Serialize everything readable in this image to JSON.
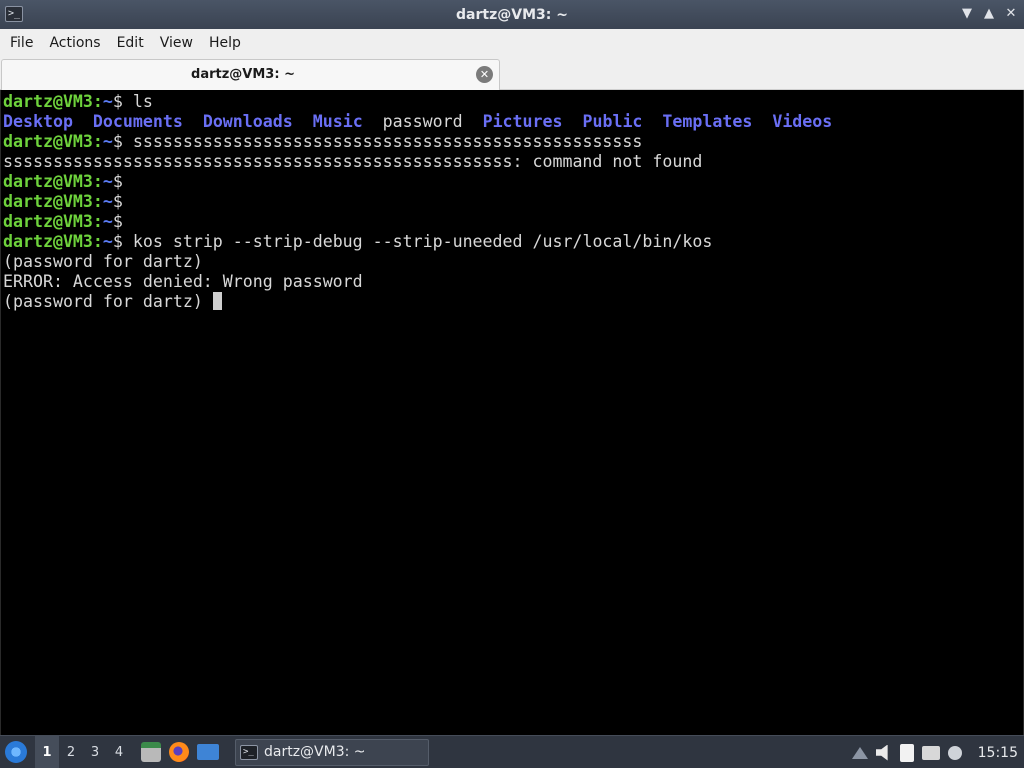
{
  "window": {
    "title": "dartz@VM3: ~",
    "controls": [
      "minimize",
      "maximize",
      "close"
    ]
  },
  "menu": [
    "File",
    "Actions",
    "Edit",
    "View",
    "Help"
  ],
  "tabs": [
    {
      "label": "dartz@VM3: ~"
    }
  ],
  "terminal": {
    "prompt_user": "dartz@VM3",
    "prompt_path": "~",
    "prompt_symbol": "$",
    "lines": [
      {
        "kind": "prompt",
        "cmd": " ls"
      },
      {
        "kind": "dirs",
        "entries": [
          {
            "name": "Desktop",
            "dir": true
          },
          {
            "name": "Documents",
            "dir": true
          },
          {
            "name": "Downloads",
            "dir": true
          },
          {
            "name": "Music",
            "dir": true
          },
          {
            "name": "password",
            "dir": false
          },
          {
            "name": "Pictures",
            "dir": true
          },
          {
            "name": "Public",
            "dir": true
          },
          {
            "name": "Templates",
            "dir": true
          },
          {
            "name": "Videos",
            "dir": true
          }
        ]
      },
      {
        "kind": "prompt",
        "cmd": " sssssssssssssssssssssssssssssssssssssssssssssssssss"
      },
      {
        "kind": "text",
        "text": "sssssssssssssssssssssssssssssssssssssssssssssssssss: command not found"
      },
      {
        "kind": "prompt",
        "cmd": ""
      },
      {
        "kind": "prompt",
        "cmd": ""
      },
      {
        "kind": "prompt",
        "cmd": ""
      },
      {
        "kind": "prompt",
        "cmd": " kos strip --strip-debug --strip-uneeded /usr/local/bin/kos"
      },
      {
        "kind": "text",
        "text": "(password for dartz)"
      },
      {
        "kind": "text",
        "text": "ERROR: Access denied: Wrong password"
      },
      {
        "kind": "text",
        "text": "(password for dartz) ",
        "cursor": true
      }
    ]
  },
  "taskbar": {
    "desktops": [
      "1",
      "2",
      "3",
      "4"
    ],
    "active_desktop": "1",
    "launchers": [
      "files-icon",
      "firefox-icon",
      "show-desktop-icon"
    ],
    "task_label": "dartz@VM3: ~",
    "tray_icons": [
      "tray-arrow-icon",
      "volume-icon",
      "clipboard-icon",
      "network-icon",
      "notification-icon"
    ],
    "clock": "15:15"
  }
}
